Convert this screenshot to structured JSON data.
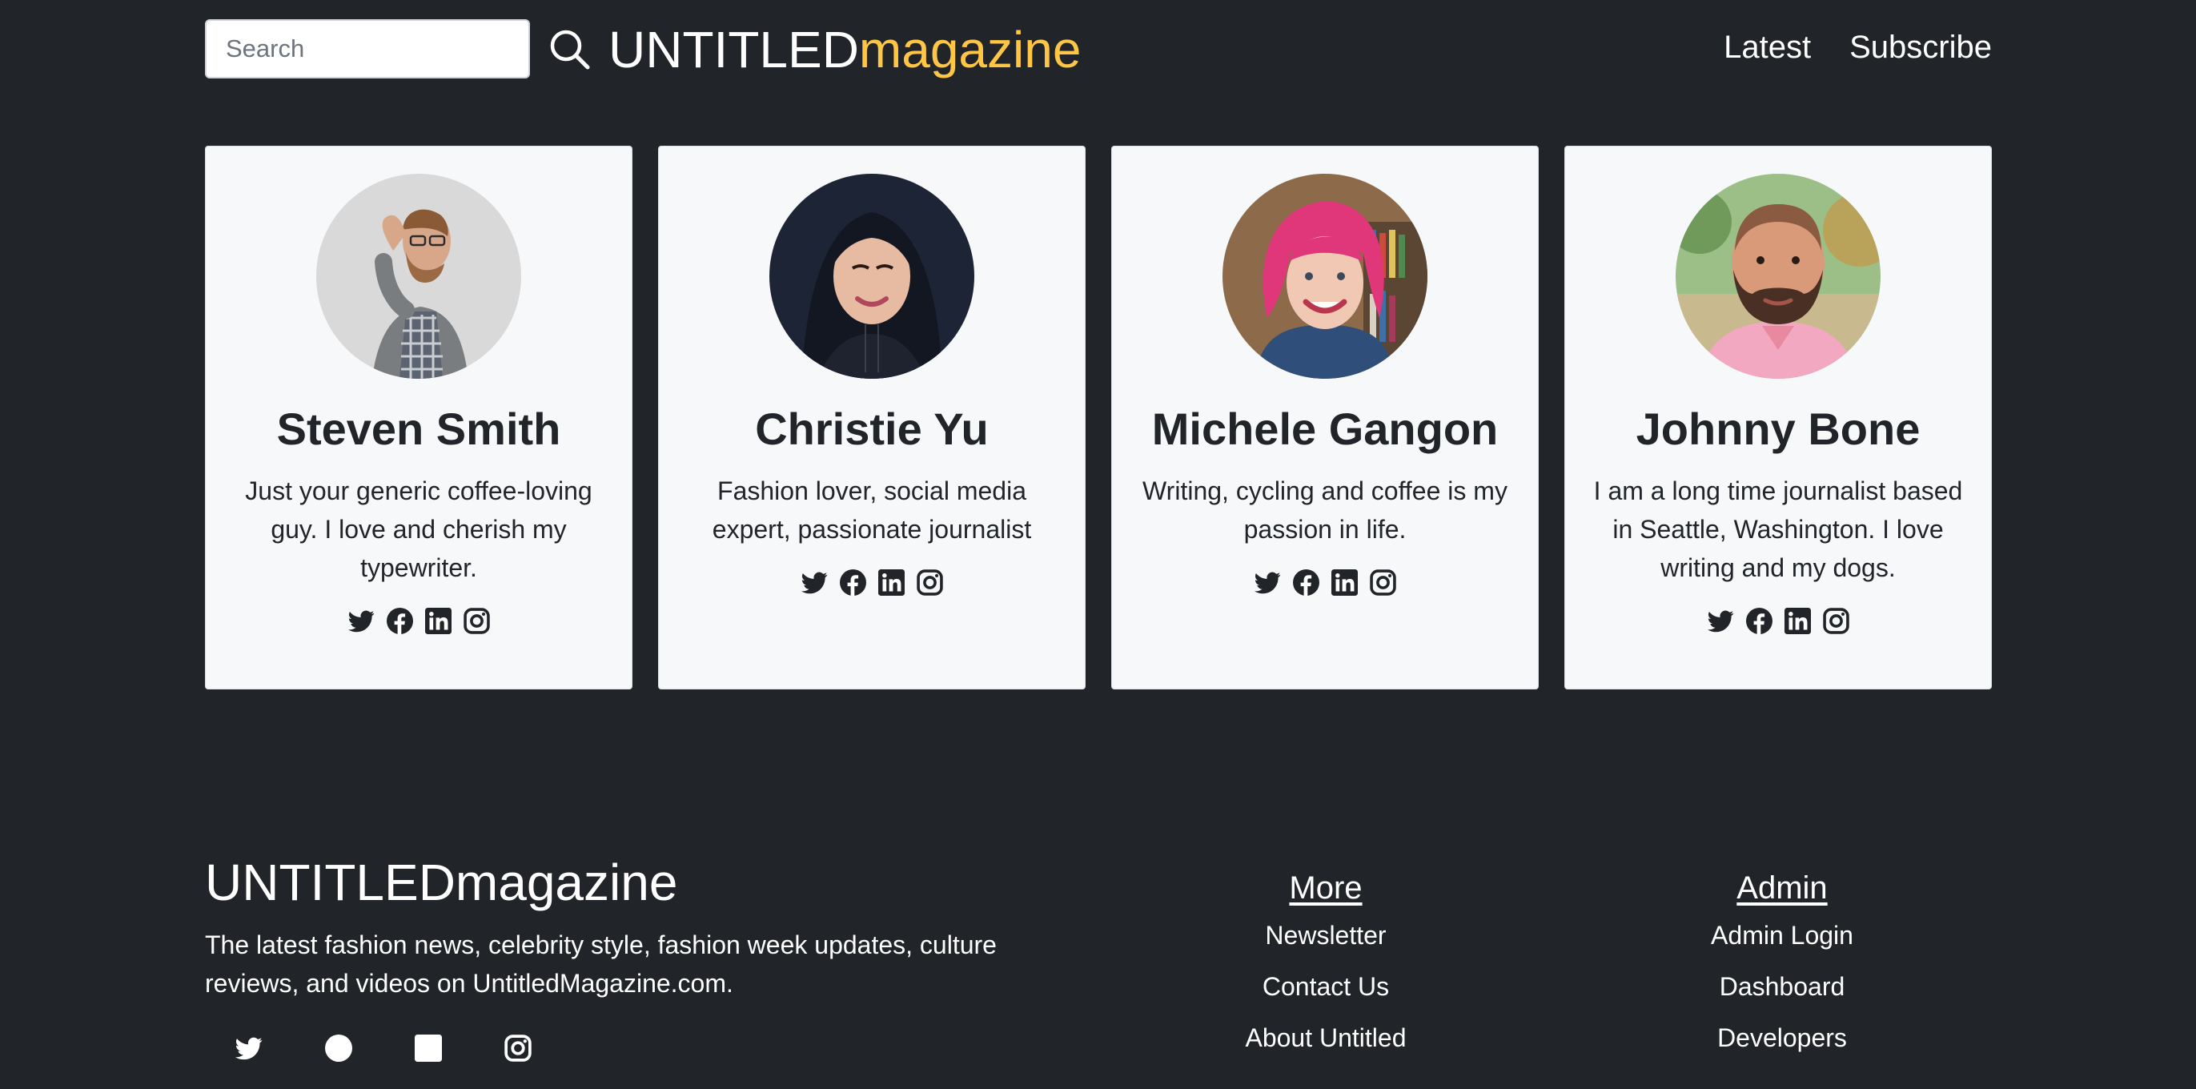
{
  "header": {
    "search_placeholder": "Search",
    "search_icon": "magnifier-icon",
    "brand_part1": "UNTITLED",
    "brand_part2": "magazine",
    "brand_accent_color": "#ffc645",
    "nav": [
      {
        "label": "Latest"
      },
      {
        "label": "Subscribe"
      }
    ]
  },
  "authors": [
    {
      "name": "Steven Smith",
      "bio": "Just your generic coffee-loving guy. I love and cherish my typewriter.",
      "avatar": "avatar-photo-man-glasses"
    },
    {
      "name": "Christie Yu",
      "bio": "Fashion lover, social media expert, passionate journalist",
      "avatar": "avatar-photo-woman-dark-hair"
    },
    {
      "name": "Michele Gangon",
      "bio": "Writing, cycling and coffee is my passion in life.",
      "avatar": "avatar-photo-woman-pink-hair"
    },
    {
      "name": "Johnny Bone",
      "bio": "I am a long time journalist based in Seattle, Washington. I love writing and my dogs.",
      "avatar": "avatar-photo-man-beard"
    }
  ],
  "social_icons": [
    "twitter-icon",
    "facebook-icon",
    "linkedin-icon",
    "instagram-icon"
  ],
  "footer": {
    "brand": "UNTITLEDmagazine",
    "description": "The latest fashion news, celebrity style, fashion week updates, culture reviews, and videos on UntitledMagazine.com.",
    "columns": [
      {
        "title": "More",
        "links": [
          {
            "label": "Newsletter"
          },
          {
            "label": "Contact Us"
          },
          {
            "label": "About Untitled"
          }
        ]
      },
      {
        "title": "Admin",
        "links": [
          {
            "label": "Admin Login"
          },
          {
            "label": "Dashboard"
          },
          {
            "label": "Developers"
          }
        ]
      }
    ]
  },
  "colors": {
    "page_background": "#212529",
    "card_background": "#f7f8fa",
    "text_dark": "#212529",
    "text_light": "#ffffff"
  }
}
